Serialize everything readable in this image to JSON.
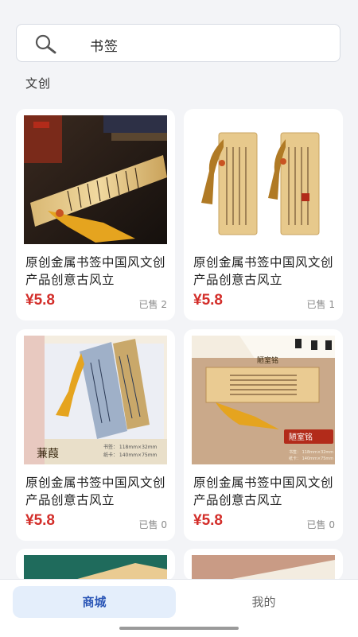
{
  "search": {
    "query": "书签"
  },
  "section": {
    "title": "文创"
  },
  "products": [
    {
      "name": "原创金属书签中国风文创产品创意古风立",
      "price": "¥5.8",
      "sold": "已售 2",
      "image_text": [
        "沁园春",
        "定价"
      ]
    },
    {
      "name": "原创金属书签中国风文创产品创意古风立",
      "price": "¥5.8",
      "sold": "已售 1",
      "image_text": [
        "琵琶行",
        "陋室铭"
      ]
    },
    {
      "name": "原创金属书签中国风文创产品创意古风立",
      "price": "¥5.8",
      "sold": "已售 0",
      "image_text": [
        "蒹葭",
        "书签： 118mm×32mm",
        "纸卡： 140mm×75mm"
      ]
    },
    {
      "name": "原创金属书签中国风文创产品创意古风立",
      "price": "¥5.8",
      "sold": "已售 0",
      "image_text": [
        "陋室铭",
        "陋室铭",
        "书签： 118mm×32mm",
        "纸卡： 140mm×75mm"
      ]
    }
  ],
  "tabs": {
    "mall": "商城",
    "mine": "我的"
  },
  "colors": {
    "price": "#d32e2a",
    "active_tab_bg": "#e4eefb",
    "active_tab_text": "#2b56b6"
  }
}
